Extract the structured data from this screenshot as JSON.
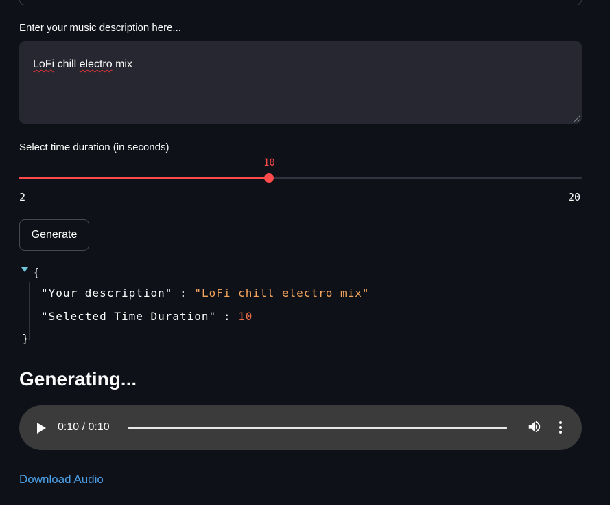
{
  "description": {
    "label": "Enter your music description here...",
    "value_words": [
      "LoFi",
      "chill",
      "electro",
      "mix"
    ]
  },
  "slider": {
    "label": "Select time duration (in seconds)",
    "value": 10,
    "value_text": "10",
    "min": 2,
    "min_text": "2",
    "max": 20,
    "max_text": "20",
    "accent_color": "#ff4b4b"
  },
  "generate_button": {
    "label": "Generate"
  },
  "json_view": {
    "open": "{",
    "close": "}",
    "separator": ":",
    "rows": [
      {
        "key": "\"Your description\"",
        "value": "\"LoFi chill electro mix\""
      },
      {
        "key": "\"Selected Time Duration\"",
        "value": "10"
      }
    ]
  },
  "status_heading": "Generating...",
  "audio": {
    "time": "0:10 / 0:10",
    "progress": 1.0,
    "icons": [
      "play-icon",
      "volume-icon",
      "more-options-icon"
    ]
  },
  "download_link": "Download Audio"
}
